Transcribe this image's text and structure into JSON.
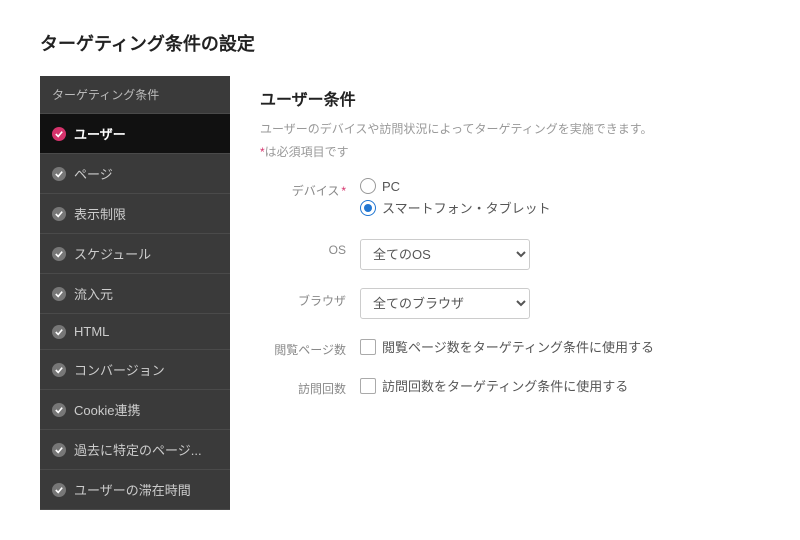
{
  "page_title": "ターゲティング条件の設定",
  "sidebar": {
    "header": "ターゲティング条件",
    "items": [
      {
        "label": "ユーザー",
        "active": true
      },
      {
        "label": "ページ",
        "active": false
      },
      {
        "label": "表示制限",
        "active": false
      },
      {
        "label": "スケジュール",
        "active": false
      },
      {
        "label": "流入元",
        "active": false
      },
      {
        "label": "HTML",
        "active": false
      },
      {
        "label": "コンバージョン",
        "active": false
      },
      {
        "label": "Cookie連携",
        "active": false
      },
      {
        "label": "過去に特定のページ...",
        "active": false
      },
      {
        "label": "ユーザーの滞在時間",
        "active": false
      }
    ]
  },
  "main": {
    "title": "ユーザー条件",
    "description": "ユーザーのデバイスや訪問状況によってターゲティングを実施できます。",
    "required_star": "*",
    "required_note": "は必須項目です",
    "form": {
      "device": {
        "label": "デバイス",
        "required": true,
        "options": [
          {
            "label": "PC",
            "selected": false
          },
          {
            "label": "スマートフォン・タブレット",
            "selected": true
          }
        ]
      },
      "os": {
        "label": "OS",
        "selected": "全てのOS"
      },
      "browser": {
        "label": "ブラウザ",
        "selected": "全てのブラウザ"
      },
      "pageviews": {
        "label": "閲覧ページ数",
        "checkbox_label": "閲覧ページ数をターゲティング条件に使用する",
        "checked": false
      },
      "visits": {
        "label": "訪問回数",
        "checkbox_label": "訪問回数をターゲティング条件に使用する",
        "checked": false
      }
    }
  }
}
